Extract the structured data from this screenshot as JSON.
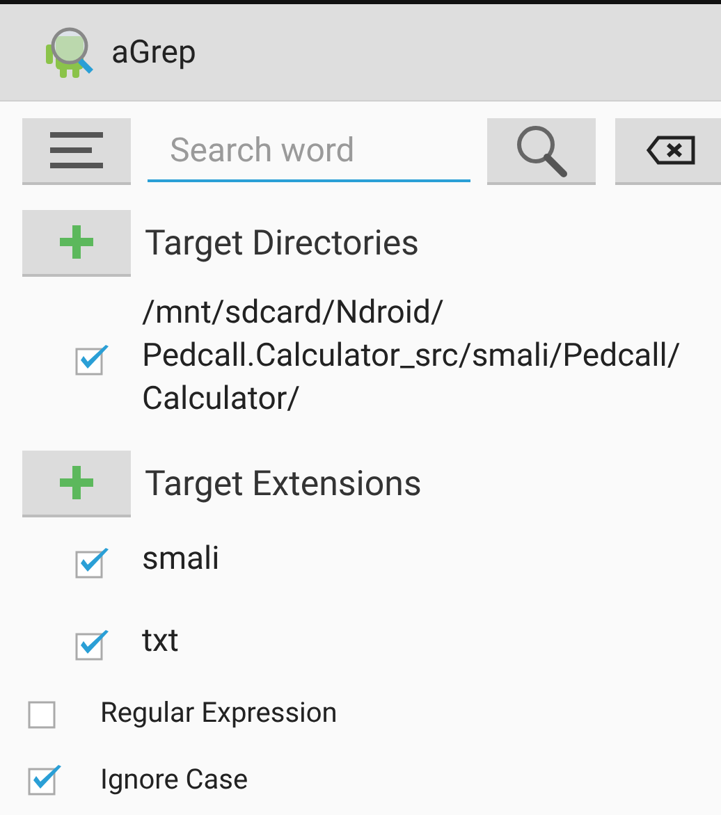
{
  "app_bar": {
    "title": "aGrep"
  },
  "toolbar": {
    "search": {
      "placeholder": "Search word"
    }
  },
  "sections": [
    {
      "title": "Target Directories",
      "items": [
        {
          "label": "/mnt/sdcard/Ndroid/Pedcall.Calculator_src/smali/Pedcall/Calculator/",
          "checked": true
        }
      ]
    },
    {
      "title": "Target Extensions",
      "items": [
        {
          "label": "smali",
          "checked": true
        },
        {
          "label": "txt",
          "checked": true
        }
      ]
    }
  ],
  "options": [
    {
      "label": "Regular Expression",
      "checked": false
    },
    {
      "label": "Ignore Case",
      "checked": true
    }
  ]
}
